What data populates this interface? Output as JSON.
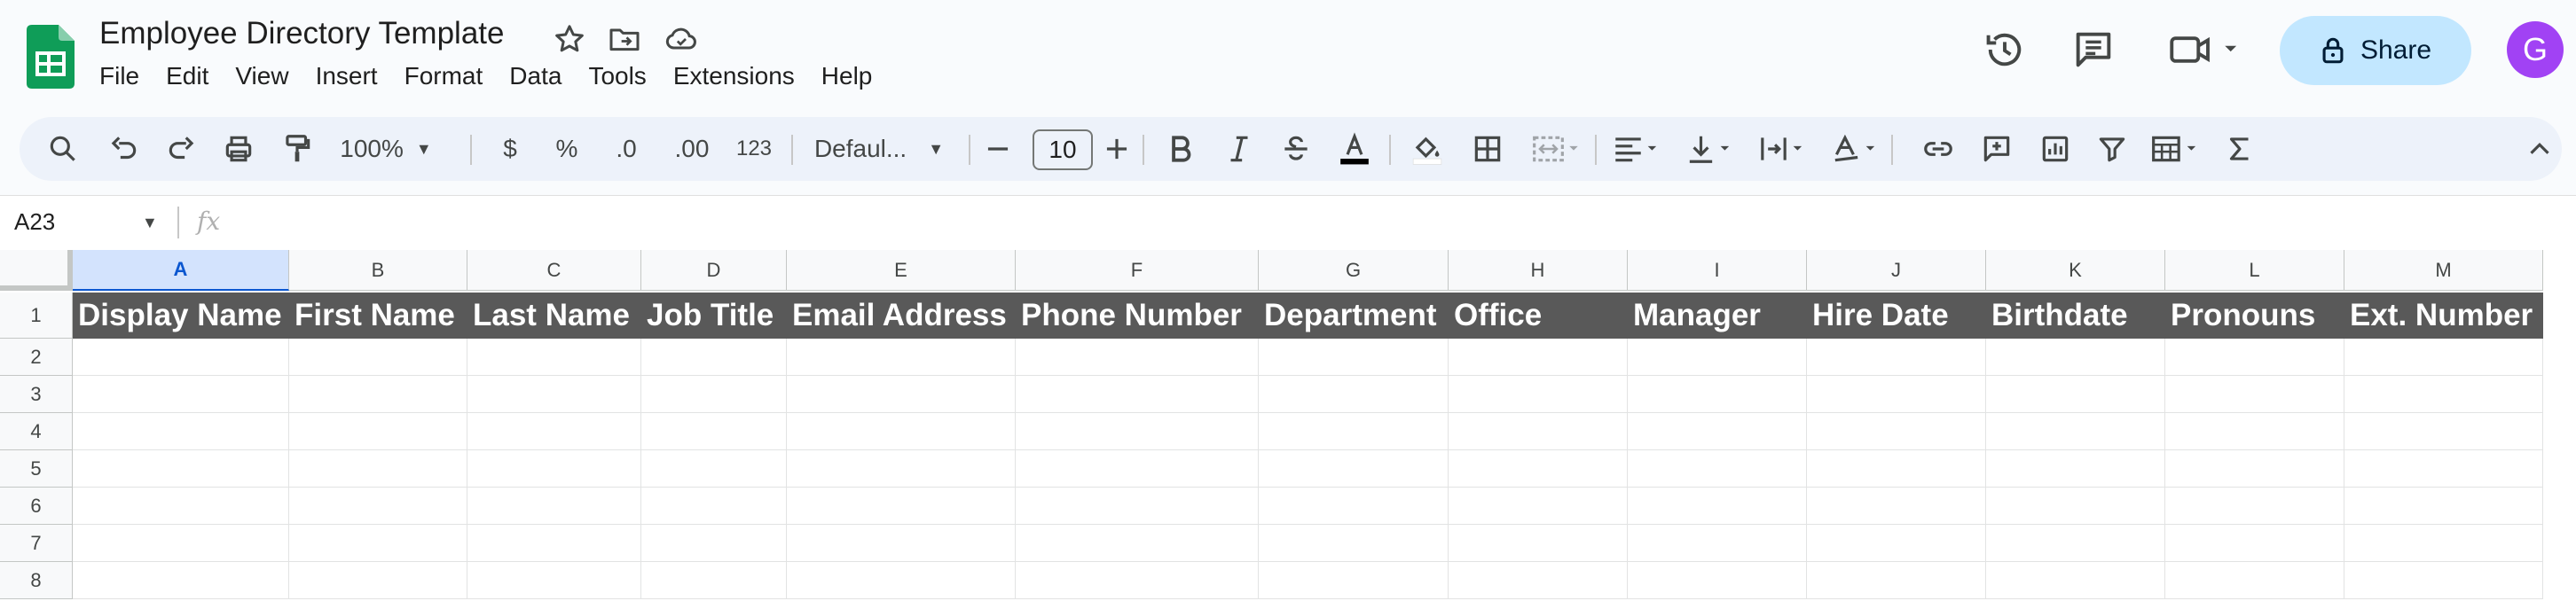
{
  "app": {
    "title": "Employee Directory Template",
    "menu": [
      "File",
      "Edit",
      "View",
      "Insert",
      "Format",
      "Data",
      "Tools",
      "Extensions",
      "Help"
    ],
    "share_label": "Share",
    "avatar_initial": "G",
    "brand_color": "#0f9d58",
    "accent_color": "#c2e7ff"
  },
  "toolbar": {
    "zoom": "100%",
    "currency": "$",
    "percent": "%",
    "decrease_decimal": ".0",
    "increase_decimal": ".00",
    "number_format": "123",
    "font": "Defaul...",
    "font_size": "10"
  },
  "formula_bar": {
    "name_box": "A23",
    "fx": "fx"
  },
  "sheet": {
    "selected_column": "A",
    "columns": [
      "A",
      "B",
      "C",
      "D",
      "E",
      "F",
      "G",
      "H",
      "I",
      "J",
      "K",
      "L",
      "M"
    ],
    "rows": [
      "1",
      "2",
      "3",
      "4",
      "5",
      "6",
      "7",
      "8"
    ],
    "header_row": [
      "Display Name",
      "First Name",
      "Last Name",
      "Job Title",
      "Email Address",
      "Phone Number",
      "Department",
      "Office",
      "Manager",
      "Hire Date",
      "Birthdate",
      "Pronouns",
      "Ext. Number"
    ],
    "header_fill": "#595959"
  }
}
